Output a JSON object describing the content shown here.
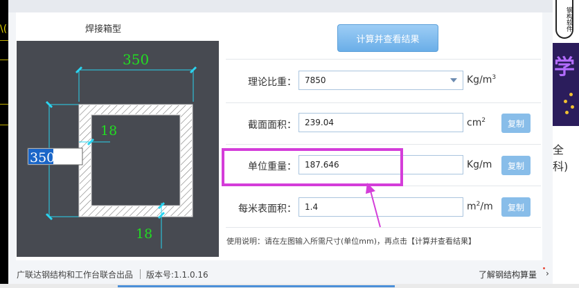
{
  "background": {
    "left_glyph": "\\(",
    "right_stamp": "钢构软件",
    "right_ad_char": "学",
    "right_text": "全科)"
  },
  "dialog": {
    "section_title": "焊接箱型",
    "calc_button": "计算并查看结果",
    "fields": {
      "density": {
        "label": "理论比重：",
        "value": "7850",
        "unit": "Kg/m",
        "unit_sup": "3"
      },
      "area": {
        "label": "截面面积：",
        "value": "239.04",
        "unit": "cm",
        "unit_sup": "2",
        "copy": "复制"
      },
      "weight": {
        "label": "单位重量：",
        "value": "187.646",
        "unit": "Kg/m",
        "copy": "复制"
      },
      "surface": {
        "label": "每米表面积：",
        "value": "1.4",
        "unit": "m",
        "unit_sup": "2",
        "unit_suffix": "/m",
        "copy": "复制"
      }
    },
    "usage": "使用说明：请在左图输入所需尺寸(单位mm)，再点击【计算并查看结果】"
  },
  "diagram": {
    "width_dim": "350",
    "height_dim": "350",
    "web_thickness": "18",
    "flange_thickness": "18"
  },
  "footer": {
    "brand": "广联达钢结构和工作台联合出品",
    "version": "版本号:1.1.0.16",
    "link": "了解钢结构算量",
    "chevron": "›"
  },
  "colors": {
    "accent": "#6aaee8",
    "highlight": "#d43dd9",
    "dim_green": "#22dd22",
    "dim_cyan": "#2ad4f0"
  }
}
